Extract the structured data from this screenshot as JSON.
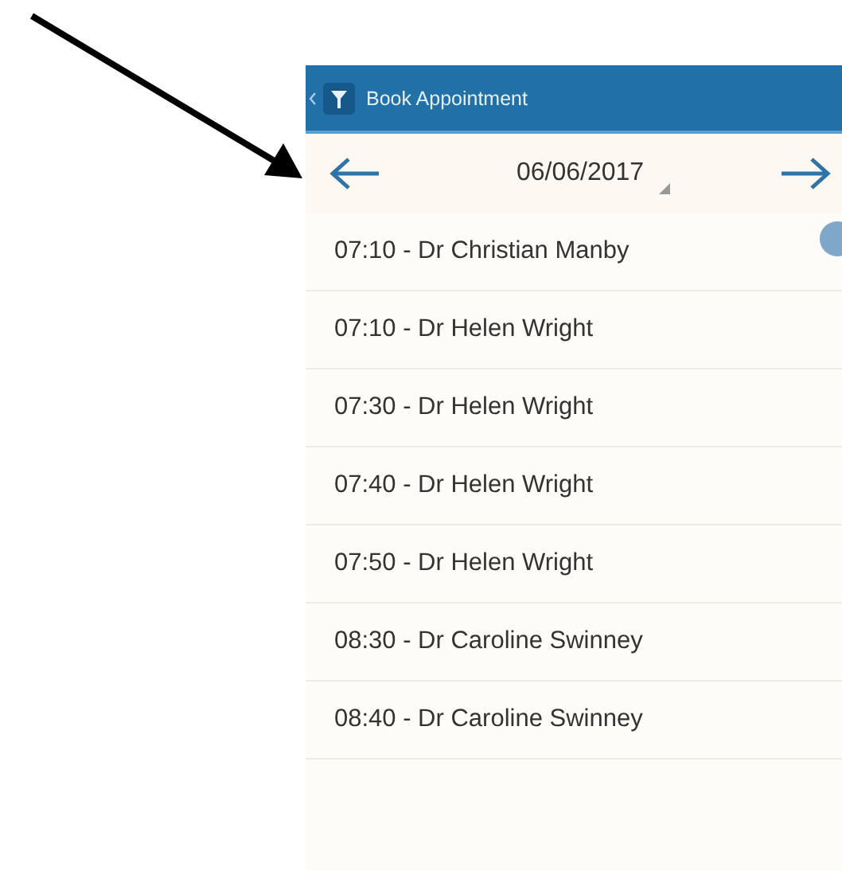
{
  "header": {
    "title": "Book Appointment"
  },
  "date_bar": {
    "date": "06/06/2017"
  },
  "appointments": [
    {
      "label": "07:10 - Dr Christian Manby"
    },
    {
      "label": "07:10 - Dr Helen Wright"
    },
    {
      "label": "07:30 - Dr Helen Wright"
    },
    {
      "label": "07:40 - Dr Helen Wright"
    },
    {
      "label": "07:50 - Dr Helen Wright"
    },
    {
      "label": "08:30 - Dr Caroline Swinney"
    },
    {
      "label": "08:40 - Dr Caroline Swinney"
    }
  ]
}
